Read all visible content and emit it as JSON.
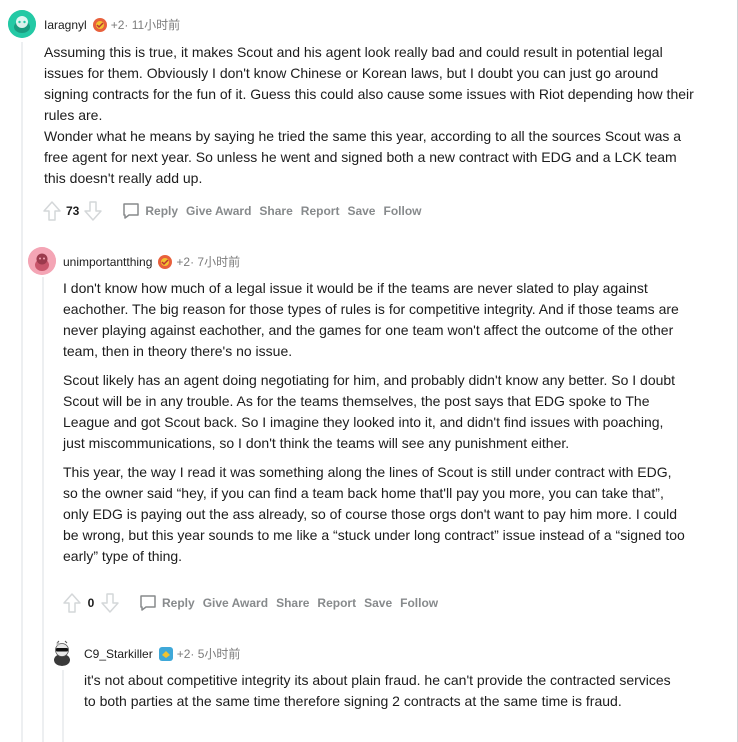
{
  "comments": [
    {
      "user": "Iaragnyl",
      "plus": "+2",
      "time": " · 11小时前",
      "paragraphs": [
        "Assuming this is true, it makes Scout and his agent look really bad and could result in potential legal issues for them. Obviously I don't know Chinese or Korean laws, but I doubt you can just go around signing contracts for the fun of it. Guess this could also cause some issues with Riot depending how their rules are.\nWonder what he means by saying he tried the same this year, according to all the sources Scout was a free agent for next year. So unless he went and signed both a new contract with EDG and a LCK team this doesn't really add up."
      ],
      "votes": "73",
      "actions": {
        "reply": "Reply",
        "award": "Give Award",
        "share": "Share",
        "report": "Report",
        "save": "Save",
        "follow": "Follow"
      },
      "avatar_color": "#24c9a5",
      "flair_colors": [
        "#e8603c",
        "#f2c230"
      ]
    },
    {
      "user": "unimportantthing",
      "plus": "+2",
      "time": " · 7小时前",
      "paragraphs": [
        "I don't know how much of a legal issue it would be if the teams are never slated to play against eachother. The big reason for those types of rules is for competitive integrity. And if those teams are never playing against eachother, and the games for one team won't affect the outcome of the other team, then in theory there's no issue.",
        "Scout likely has an agent doing negotiating for him, and probably didn't know any better. So I doubt Scout will be in any trouble. As for the teams themselves, the post says that EDG spoke to The League and got Scout back. So I imagine they looked into it, and didn't find issues with poaching, just miscommunications, so I don't think the teams will see any punishment either.",
        "This year, the way I read it was something along the lines of Scout is still under contract with EDG, so the owner said “hey, if you can find a team back home that'll pay you more, you can take that”, only EDG is paying out the ass already, so of course those orgs don't want to pay him more. I could be wrong, but this year sounds to me like a “stuck under long contract” issue instead of a “signed too early” type of thing."
      ],
      "votes": "0",
      "actions": {
        "reply": "Reply",
        "award": "Give Award",
        "share": "Share",
        "report": "Report",
        "save": "Save",
        "follow": "Follow"
      },
      "avatar_color": "#f4a5b5",
      "flair_colors": [
        "#e8603c",
        "#f2c230"
      ]
    },
    {
      "user": "C9_Starkiller",
      "plus": "+2",
      "time": " · 5小时前",
      "paragraphs": [
        "it's not about competitive integrity its about plain fraud. he can't provide the contracted services to both parties at the same time therefore signing 2 contracts at the same time is fraud."
      ],
      "avatar_color": "#ffffff",
      "flair_colors": [
        "#3fa8d8",
        "#f2c230"
      ]
    }
  ]
}
